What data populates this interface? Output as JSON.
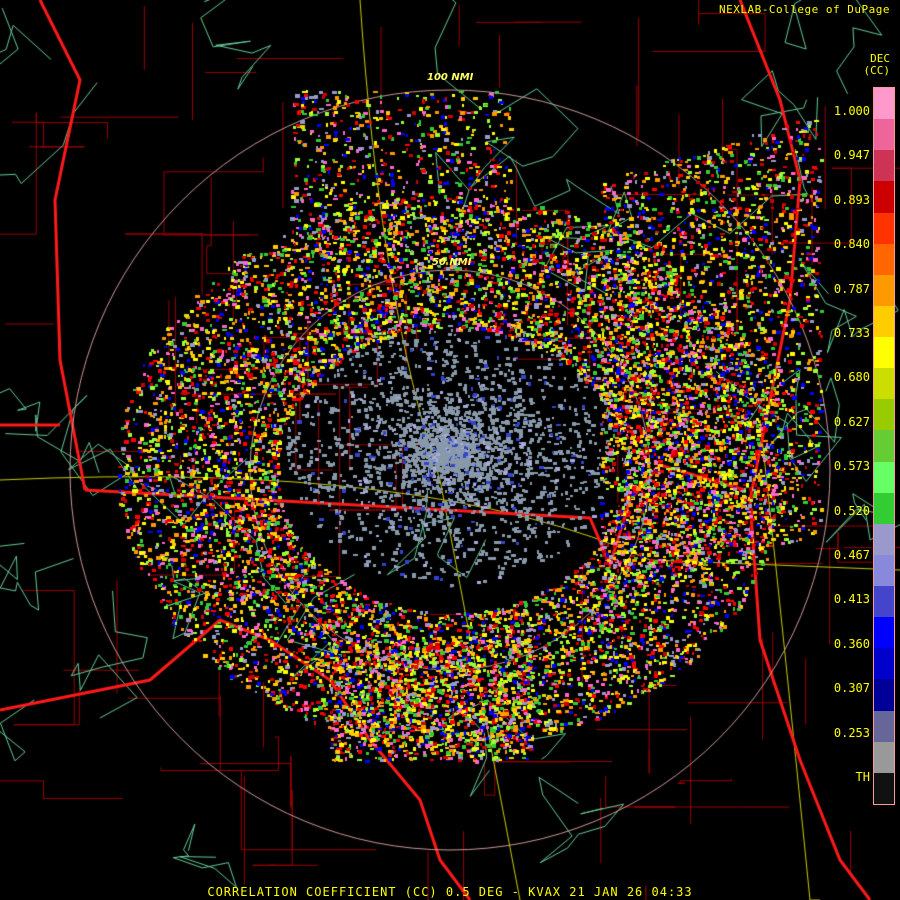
{
  "credit": "NEXLAB-College of DuPage",
  "footer": "CORRELATION COEFFICIENT (CC) 0.5 DEG - KVAX 21 JAN 26 04:33",
  "legend": {
    "units_line1": "DEC",
    "units_line2": "(CC)",
    "ticks": [
      "1.000",
      "0.947",
      "0.893",
      "0.840",
      "0.787",
      "0.733",
      "0.680",
      "0.627",
      "0.573",
      "0.520",
      "0.467",
      "0.413",
      "0.360",
      "0.307",
      "0.253",
      "TH"
    ],
    "colors": [
      "#ff99cc",
      "#ee6699",
      "#cc3355",
      "#cc0000",
      "#ff3300",
      "#ff6600",
      "#ff9900",
      "#ffcc00",
      "#ffff00",
      "#ccdd00",
      "#99cc00",
      "#66cc33",
      "#66ff66",
      "#33cc33",
      "#9999cc",
      "#8888dd",
      "#4444cc",
      "#0000ff",
      "#0000cc",
      "#000099",
      "#666699",
      "#999999",
      "#111111"
    ]
  },
  "range_rings": {
    "inner_label": "50 NMI",
    "outer_label": "100 NMI"
  },
  "icons": {
    "logo": "college-logo-icon"
  }
}
